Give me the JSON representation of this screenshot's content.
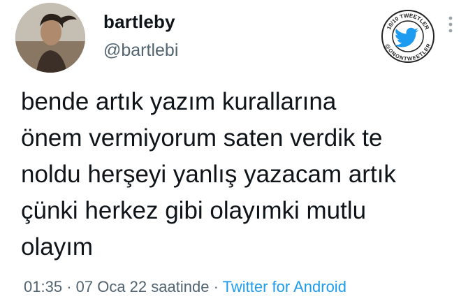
{
  "user": {
    "display_name": "bartleby",
    "handle": "@bartlebi"
  },
  "watermark": {
    "top_text": "10/10 TWEETLER",
    "bottom_text": "@ONONTWEETLER",
    "icon": "twitter-bird-icon",
    "color": "#1d9bf0"
  },
  "more_icon": "more-vertical-icon",
  "tweet": {
    "lines": [
      "bende artık yazım kurallarına",
      "önem vermiyorum saten verdik te",
      "noldu herşeyi yanlış yazacam artık",
      "çünki herkez gibi olayımki mutlu",
      "olayım"
    ]
  },
  "meta": {
    "time": "01:35",
    "separator": "·",
    "date": "07 Oca 22 saatinde",
    "source": "Twitter for Android",
    "source_color": "#1d9bf0"
  }
}
